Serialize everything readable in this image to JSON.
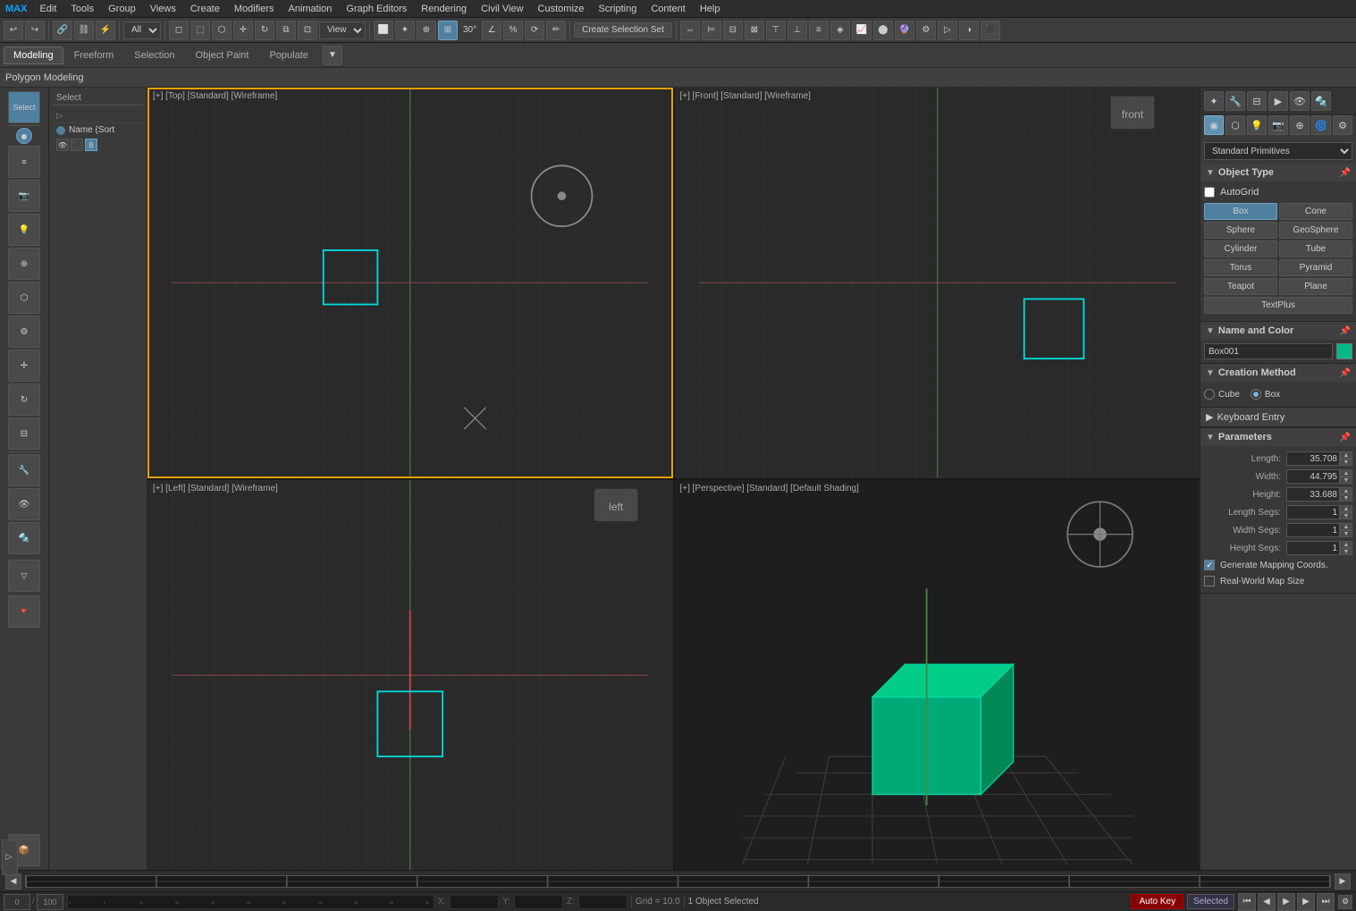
{
  "menu": {
    "logo": "MAX",
    "items": [
      "Edit",
      "Tools",
      "Group",
      "Views",
      "Create",
      "Modifiers",
      "Animation",
      "Graph Editors",
      "Rendering",
      "Civil View",
      "Customize",
      "Scripting",
      "Content",
      "Help"
    ]
  },
  "toolbar": {
    "undo_label": "↩",
    "redo_label": "↪",
    "all_dropdown": "All",
    "view_dropdown": "View",
    "create_sel_btn": "Create Selection Set",
    "angle_snap_label": "30°"
  },
  "tabs": {
    "modeling": "Modeling",
    "freeform": "Freeform",
    "selection": "Selection",
    "object_paint": "Object Paint",
    "populate": "Populate"
  },
  "ribbon_label": "Polygon Modeling",
  "scene": {
    "select_label": "Select",
    "name_sort_label": "Name (Sort"
  },
  "viewports": {
    "top": "[+] [Top] [Standard] [Wireframe]",
    "front": "[+] [Front] [Standard] [Wireframe]",
    "left": "[+] [Left] [Standard] [Wireframe]",
    "perspective": "[+] [Perspective] [Standard] [Default Shading]"
  },
  "right_panel": {
    "dropdown_label": "Standard Primitives",
    "object_type": {
      "title": "Object Type",
      "autogrid": "AutoGrid",
      "buttons": [
        "Box",
        "Cone",
        "Sphere",
        "GeoSphere",
        "Cylinder",
        "Tube",
        "Torus",
        "Pyramid",
        "Teapot",
        "Plane",
        "TextPlus"
      ]
    },
    "name_and_color": {
      "title": "Name and Color",
      "name_value": "Box001",
      "color": "#00bb88"
    },
    "creation_method": {
      "title": "Creation Method",
      "options": [
        "Cube",
        "Box"
      ],
      "selected": "Box"
    },
    "keyboard_entry": {
      "title": "Keyboard Entry"
    },
    "parameters": {
      "title": "Parameters",
      "length_label": "Length:",
      "length_value": "35.708",
      "width_label": "Width:",
      "width_value": "44.795",
      "height_label": "Height:",
      "height_value": "33.688",
      "length_segs_label": "Length Segs:",
      "length_segs_value": "1",
      "width_segs_label": "Width Segs:",
      "width_segs_value": "1",
      "height_segs_label": "Height Segs:",
      "height_segs_value": "1",
      "gen_mapping": "Generate Mapping Coords.",
      "real_world": "Real-World Map Size"
    }
  },
  "status": {
    "objects_selected": "1 Object Selected",
    "timeline_pos": "0 / 100",
    "x_coord": "",
    "y_coord": "",
    "z_coord": "",
    "x_label": "X:",
    "y_label": "Y:",
    "z_label": "Z:",
    "grid_label": "Grid = 10.0",
    "autokey_label": "Auto Key",
    "selected_label": "Selected"
  },
  "playback": {
    "prev_frame": "⏮",
    "prev": "◀",
    "play": "▶",
    "next": "▶",
    "next_frame": "⏭"
  }
}
